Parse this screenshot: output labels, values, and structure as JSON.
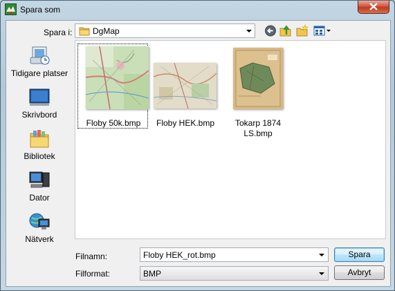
{
  "window": {
    "title": "Spara som"
  },
  "toolbar": {
    "save_in_label": "Spara i:",
    "save_in_value": "DgMap"
  },
  "places": [
    {
      "label": "Tidigare platser",
      "icon": "recent-places-icon"
    },
    {
      "label": "Skrivbord",
      "icon": "desktop-icon"
    },
    {
      "label": "Bibliotek",
      "icon": "libraries-icon"
    },
    {
      "label": "Dator",
      "icon": "computer-icon"
    },
    {
      "label": "Nätverk",
      "icon": "network-icon"
    }
  ],
  "files": [
    {
      "name": "Floby 50k.bmp",
      "selected": true
    },
    {
      "name": "Floby HEK.bmp"
    },
    {
      "name": "Tokarp 1874 LS.bmp"
    }
  ],
  "form": {
    "filename_label": "Filnamn:",
    "filename_value": "Floby HEK_rot.bmp",
    "format_label": "Filformat:",
    "format_value": "BMP"
  },
  "buttons": {
    "save": "Spara",
    "cancel": "Avbryt"
  },
  "colors": {
    "close_red": "#c8432a",
    "default_button_blue": "#3c7fb1"
  }
}
